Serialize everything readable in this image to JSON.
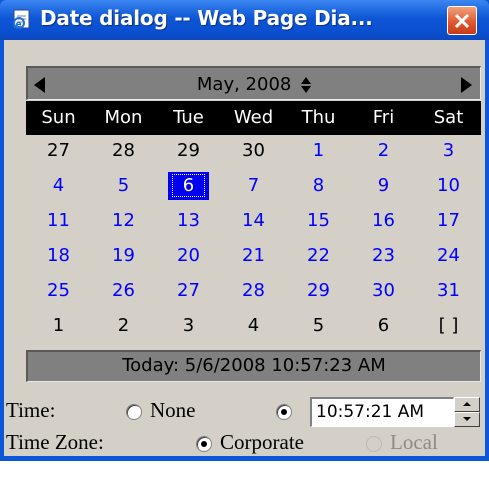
{
  "window": {
    "title": "Date dialog -- Web Page Dia..."
  },
  "calendar": {
    "month_label": "May, 2008",
    "weekdays": [
      "Sun",
      "Mon",
      "Tue",
      "Wed",
      "Thu",
      "Fri",
      "Sat"
    ],
    "rows": [
      [
        "27",
        "28",
        "29",
        "30",
        "1",
        "2",
        "3"
      ],
      [
        "4",
        "5",
        "6",
        "7",
        "8",
        "9",
        "10"
      ],
      [
        "11",
        "12",
        "13",
        "14",
        "15",
        "16",
        "17"
      ],
      [
        "18",
        "19",
        "20",
        "21",
        "22",
        "23",
        "24"
      ],
      [
        "25",
        "26",
        "27",
        "28",
        "29",
        "30",
        "31"
      ],
      [
        "1",
        "2",
        "3",
        "4",
        "5",
        "6",
        "[ ]"
      ]
    ],
    "selected_day": "6",
    "today_text": "Today: 5/6/2008 10:57:23 AM"
  },
  "time": {
    "label": "Time:",
    "none_label": "None",
    "value": "10:57:21 AM",
    "selected_option": "time"
  },
  "timezone": {
    "label": "Time Zone:",
    "corporate_label": "Corporate",
    "local_label": "Local",
    "selected_option": "corporate"
  },
  "colors": {
    "titlebar": "#0a58d8",
    "current_month_day": "#0000ff",
    "selected_day_bg": "#0000ee",
    "close_button": "#e1592f"
  },
  "icons": {
    "window": "ie-page-icon",
    "close": "close-icon",
    "prev": "triangle-left-icon",
    "next": "triangle-right-icon",
    "month_spin": "up-down-arrows-icon"
  }
}
